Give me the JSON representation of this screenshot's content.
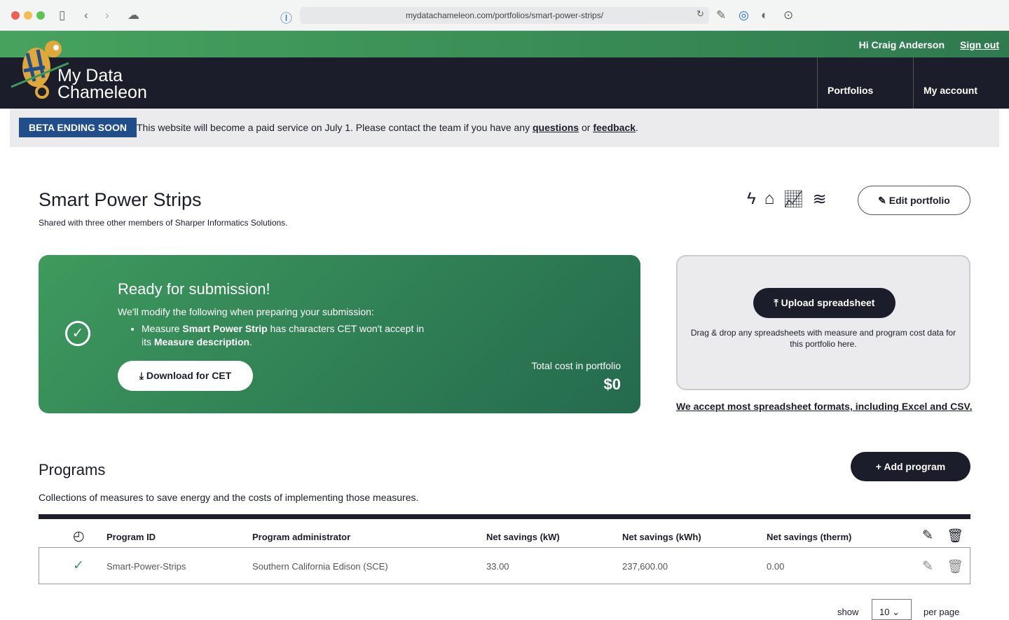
{
  "browser": {
    "url": "mydatachameleon.com/portfolios/smart-power-strips/"
  },
  "header": {
    "greeting": "Hi Craig Anderson",
    "sign_out": "Sign out",
    "logo": "My Data Chameleon",
    "logo_line1": "My Data",
    "logo_line2": "Chameleon",
    "nav": [
      "Portfolios",
      "My account"
    ]
  },
  "banner": {
    "badge": "BETA ENDING SOON",
    "text": "This website will become a paid service on July 1. Please contact the team if you have any ",
    "questions": "questions",
    "or": " or ",
    "feedback": "feedback",
    "end": "."
  },
  "portfolio": {
    "title": "Smart Power Strips",
    "subtitle": "Shared with three other members of Sharper Informatics Solutions.",
    "edit": "Edit portfolio"
  },
  "status": {
    "title": "Ready for submission!",
    "intro": "We'll modify the following when preparing your submission:",
    "item_pre": "Measure ",
    "item_measure": "Smart Power Strip",
    "item_mid": " has characters CET won't accept in its ",
    "item_field": "Measure description",
    "item_end": ".",
    "download": "Download for CET",
    "total_label": "Total cost in portfolio",
    "total_value": "$0"
  },
  "upload": {
    "button": "Upload spreadsheet",
    "text": "Drag & drop any spreadsheets with measure and program cost data for this portfolio here.",
    "accept": "We accept most spreadsheet formats, including Excel and CSV."
  },
  "programs": {
    "title": "Programs",
    "subtitle": "Collections of measures to save energy and the costs of implementing those measures.",
    "add": "Add program",
    "columns": [
      "Program ID",
      "Program administrator",
      "Net savings (kW)",
      "Net savings (kWh)",
      "Net savings (therm)"
    ],
    "rows": [
      [
        "Smart-Power-Strips",
        "Southern California Edison (SCE)",
        "33.00",
        "237,600.00",
        "0.00"
      ]
    ],
    "show": "show",
    "per_page_value": "10",
    "per_page": "per page"
  }
}
